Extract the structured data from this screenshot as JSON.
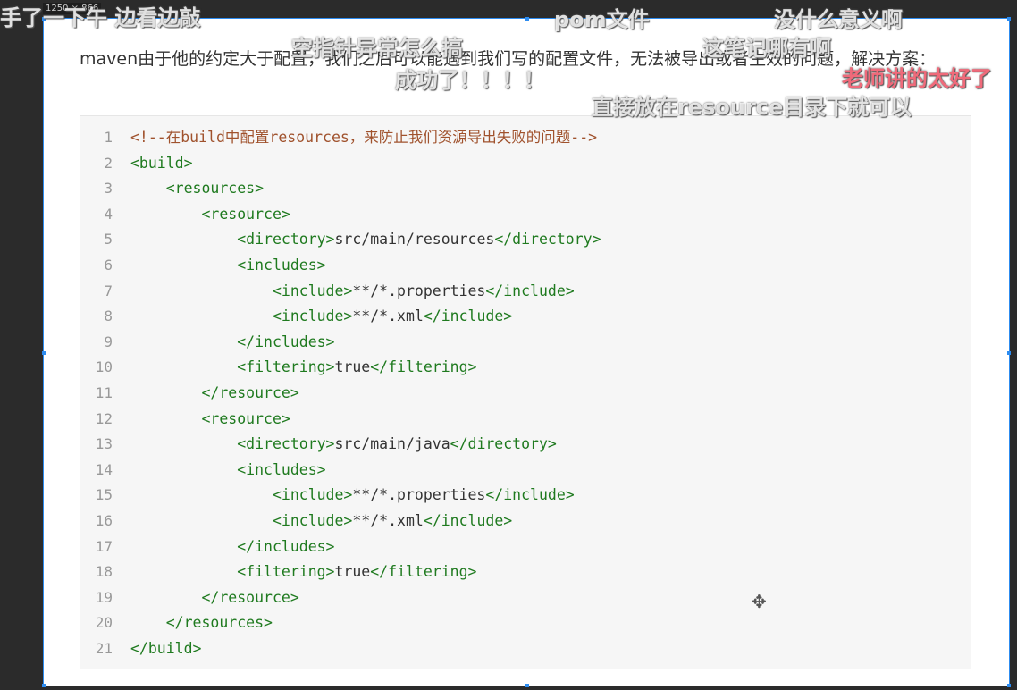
{
  "window": {
    "dimension_label": "1250 × 866"
  },
  "article": {
    "intro": "maven由于他的约定大于配置，我们之后可以能遇到我们写的配置文件，无法被导出或者生效的问题，解决方案："
  },
  "code_lines": [
    {
      "n": "1",
      "text": "<!--在build中配置resources，来防止我们资源导出失败的问题-->",
      "kind": "comment"
    },
    {
      "n": "2",
      "text": "<build>",
      "kind": "tag"
    },
    {
      "n": "3",
      "text": "    <resources>",
      "kind": "tag"
    },
    {
      "n": "4",
      "text": "        <resource>",
      "kind": "tag"
    },
    {
      "n": "5",
      "text": "            <directory>src/main/resources</directory>",
      "kind": "mixed"
    },
    {
      "n": "6",
      "text": "            <includes>",
      "kind": "tag"
    },
    {
      "n": "7",
      "text": "                <include>**/*.properties</include>",
      "kind": "mixed"
    },
    {
      "n": "8",
      "text": "                <include>**/*.xml</include>",
      "kind": "mixed"
    },
    {
      "n": "9",
      "text": "            </includes>",
      "kind": "tag"
    },
    {
      "n": "10",
      "text": "            <filtering>true</filtering>",
      "kind": "mixed"
    },
    {
      "n": "11",
      "text": "        </resource>",
      "kind": "tag"
    },
    {
      "n": "12",
      "text": "        <resource>",
      "kind": "tag"
    },
    {
      "n": "13",
      "text": "            <directory>src/main/java</directory>",
      "kind": "mixed"
    },
    {
      "n": "14",
      "text": "            <includes>",
      "kind": "tag"
    },
    {
      "n": "15",
      "text": "                <include>**/*.properties</include>",
      "kind": "mixed"
    },
    {
      "n": "16",
      "text": "                <include>**/*.xml</include>",
      "kind": "mixed"
    },
    {
      "n": "17",
      "text": "            </includes>",
      "kind": "tag"
    },
    {
      "n": "18",
      "text": "            <filtering>true</filtering>",
      "kind": "mixed"
    },
    {
      "n": "19",
      "text": "        </resource>",
      "kind": "tag"
    },
    {
      "n": "20",
      "text": "    </resources>",
      "kind": "tag"
    },
    {
      "n": "21",
      "text": "</build>",
      "kind": "tag"
    }
  ],
  "danmaku": [
    {
      "text": "手了一下午 边看边敲",
      "style": "white"
    },
    {
      "text": "pom文件",
      "style": "white"
    },
    {
      "text": "没什么意义啊",
      "style": "white"
    },
    {
      "text": "空指针异常怎么搞",
      "style": "white"
    },
    {
      "text": "这笔记哪有啊",
      "style": "white"
    },
    {
      "text": "成功了！！！！",
      "style": "white"
    },
    {
      "text": "老师讲的太好了",
      "style": "pink"
    },
    {
      "text": "直接放在resource目录下就可以",
      "style": "white"
    }
  ],
  "icons": {
    "cursor": "move-cursor-icon"
  },
  "colors": {
    "frame_border": "#2d8cf0",
    "tag": "#1f7a1f",
    "comment": "#a0522d"
  }
}
